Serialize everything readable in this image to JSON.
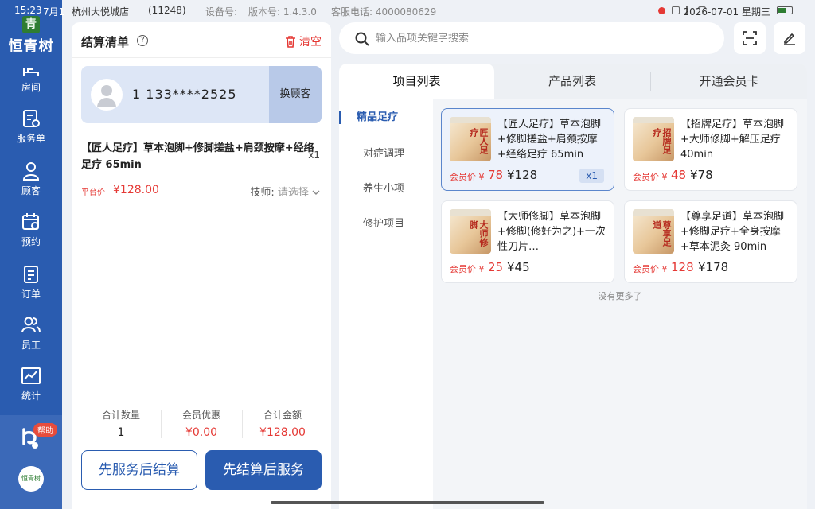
{
  "status": {
    "time": "15:23",
    "date_short": "7月1",
    "store": "杭州大悦城店",
    "store_id": "(11248)",
    "device_label": "设备号:",
    "version": "版本号: 1.4.3.0",
    "service_phone": "客服电话: 4000080629",
    "datetime": "2026-07-01 星期三"
  },
  "sidebar": {
    "logo_char": "青",
    "brand": "恒青树",
    "items": [
      {
        "label": "房间",
        "icon": "room-icon"
      },
      {
        "label": "服务单",
        "icon": "service-order-icon"
      },
      {
        "label": "顾客",
        "icon": "customer-icon"
      },
      {
        "label": "预约",
        "icon": "calendar-icon"
      },
      {
        "label": "订单",
        "icon": "order-icon"
      },
      {
        "label": "员工",
        "icon": "staff-icon"
      },
      {
        "label": "统计",
        "icon": "stats-icon"
      }
    ],
    "help_badge": "帮助",
    "bottom_logo": "恒青树"
  },
  "cart": {
    "title": "结算清单",
    "clear_label": "清空",
    "customer_phone": "1 133****2525",
    "switch_customer": "换顾客",
    "item_name": "【匠人足疗】草本泡脚+修脚搓盐+肩颈按摩+经络足疗 65min",
    "item_qty": "x1",
    "platform_label": "平台价",
    "platform_price": "¥128.00",
    "tech_label": "技师:",
    "tech_placeholder": "请选择",
    "summary": {
      "qty_label": "合计数量",
      "qty_value": "1",
      "discount_label": "会员优惠",
      "discount_value": "¥0.00",
      "total_label": "合计金额",
      "total_value": "¥128.00"
    },
    "btn_service_first": "先服务后结算",
    "btn_pay_first": "先结算后服务"
  },
  "search": {
    "placeholder": "输入品项关键字搜索"
  },
  "tabs": [
    "项目列表",
    "产品列表",
    "开通会员卡"
  ],
  "categories": [
    "精品足疗",
    "对症调理",
    "养生小项",
    "修护项目"
  ],
  "products": [
    {
      "title": "【匠人足疗】草本泡脚+修脚搓盐+肩颈按摩+经络足疗 65min",
      "thumb_text": "匠人足疗",
      "member_label": "会员价 ¥",
      "member_price": "78",
      "price": "¥128",
      "qty": "x1"
    },
    {
      "title": "【招牌足疗】草本泡脚+大师修脚+解压足疗 40min",
      "thumb_text": "招牌足疗",
      "member_label": "会员价 ¥",
      "member_price": "48",
      "price": "¥78"
    },
    {
      "title": "【大师修脚】草本泡脚+修脚(修好为之)+一次性刀片…",
      "thumb_text": "大师修脚",
      "member_label": "会员价 ¥",
      "member_price": "25",
      "price": "¥45"
    },
    {
      "title": "【尊享足道】草本泡脚+修脚足疗+全身按摩+草本泥灸 90min",
      "thumb_text": "尊享足道",
      "member_label": "会员价 ¥",
      "member_price": "128",
      "price": "¥178"
    }
  ],
  "no_more": "没有更多了",
  "colors": {
    "primary": "#2a5cb0",
    "price_red": "#e53935",
    "brand_green": "#2e7d32"
  }
}
